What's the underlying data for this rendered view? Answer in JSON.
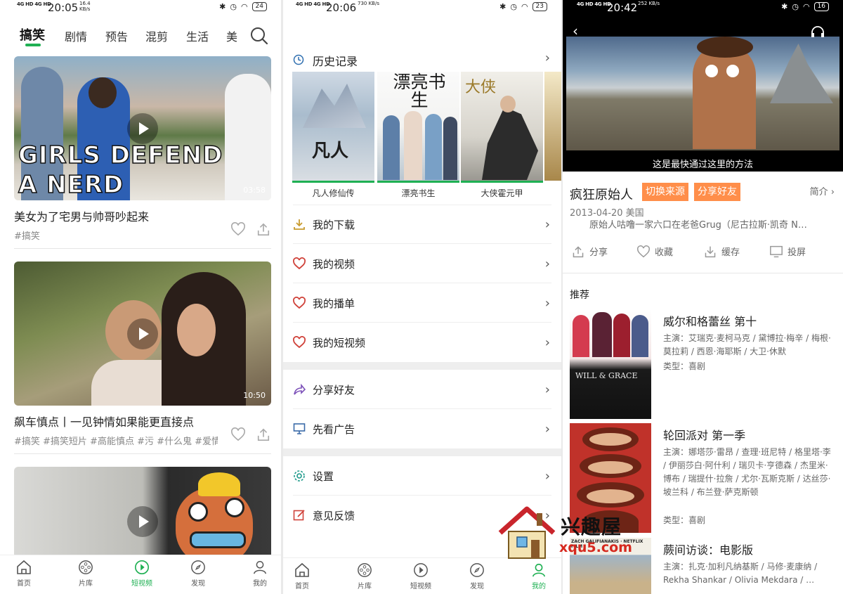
{
  "colors": {
    "accent": "#1fb053",
    "orange": "#ff8e4a"
  },
  "phone1": {
    "status": {
      "net": "4G HD 4G HD",
      "time": "20:05",
      "speed": "16.4\nKB/s",
      "battery": "24"
    },
    "tabs": [
      "搞笑",
      "剧情",
      "预告",
      "混剪",
      "生活",
      "美"
    ],
    "videos": [
      {
        "overlay": "GIRLS DEFEND\nA NERD",
        "duration": "03:58",
        "title": "美女为了宅男与帅哥吵起来",
        "tags": "#搞笑"
      },
      {
        "overlay": "",
        "duration": "10:50",
        "title": "飙车慎点丨一见钟情如果能更直接点",
        "tags": "#搞笑 #搞笑短片 #高能慎点 #污 #什么鬼 #爱情"
      },
      {
        "overlay": "",
        "duration": "",
        "title": "",
        "tags": ""
      }
    ],
    "nav": [
      "首页",
      "片库",
      "短视频",
      "发现",
      "我的"
    ]
  },
  "phone2": {
    "status": {
      "net": "4G HD 4G HD",
      "time": "20:06",
      "speed": "730\nKB/s",
      "battery": "23"
    },
    "history_label": "历史记录",
    "posters": [
      {
        "caption": "凡人修仙传",
        "art": "凡人"
      },
      {
        "caption": "漂亮书生",
        "art": "漂亮书生"
      },
      {
        "caption": "大侠霍元甲",
        "art": "大侠"
      }
    ],
    "menu": [
      "我的下载",
      "我的视频",
      "我的播单",
      "我的短视频",
      "分享好友",
      "先看广告",
      "设置",
      "意见反馈"
    ],
    "nav": [
      "首页",
      "片库",
      "短视频",
      "发现",
      "我的"
    ]
  },
  "phone3": {
    "status": {
      "net": "4G HD 4G HD",
      "time": "20:42",
      "speed": "252\nKB/s",
      "battery": "16"
    },
    "subtitle": "这是最快通过这里的方法",
    "title": "疯狂原始人",
    "switch_source": "切换来源",
    "share_friends": "分享好友",
    "intro": "简介",
    "meta": "2013-04-20  美国",
    "desc": "原始人咕噜一家六口在老爸Grug（尼古拉斯·凯奇 N…",
    "actions": [
      "分享",
      "收藏",
      "缓存",
      "投屏"
    ],
    "rec_title": "推荐",
    "recs": [
      {
        "name": "威尔和格蕾丝 第十",
        "cast": "主演：艾瑞克·麦柯马克 / 黛博拉·梅辛 / 梅根·莫拉莉 / 西恩·海耶斯 / 大卫·休默",
        "genre": "类型：喜剧",
        "art": "WILL & GRACE"
      },
      {
        "name": "轮回派对 第一季",
        "cast": "主演：娜塔莎·雷昂 / 查理·班尼特 / 格里塔·李 / 伊丽莎白·阿什利 / 瑞贝卡·亨德森 / 杰里米·博布 / 瑞提什·拉詹 / 尤尔·瓦斯克斯 / 达丝莎·坡兰科 / 布兰登·萨克斯顿",
        "genre": "类型：喜剧",
        "art": ""
      },
      {
        "name": "蕨间访谈：电影版",
        "cast": "主演：扎克·加利凡纳基斯 / 马修·麦康纳 / Rekha Shankar / Olivia Mekdara / …",
        "genre": "",
        "art": "ZACH GALIFIANAKIS · NETFLIX FILM"
      }
    ]
  },
  "watermark": {
    "cn": "兴趣屋",
    "en": "xqu5.com"
  }
}
